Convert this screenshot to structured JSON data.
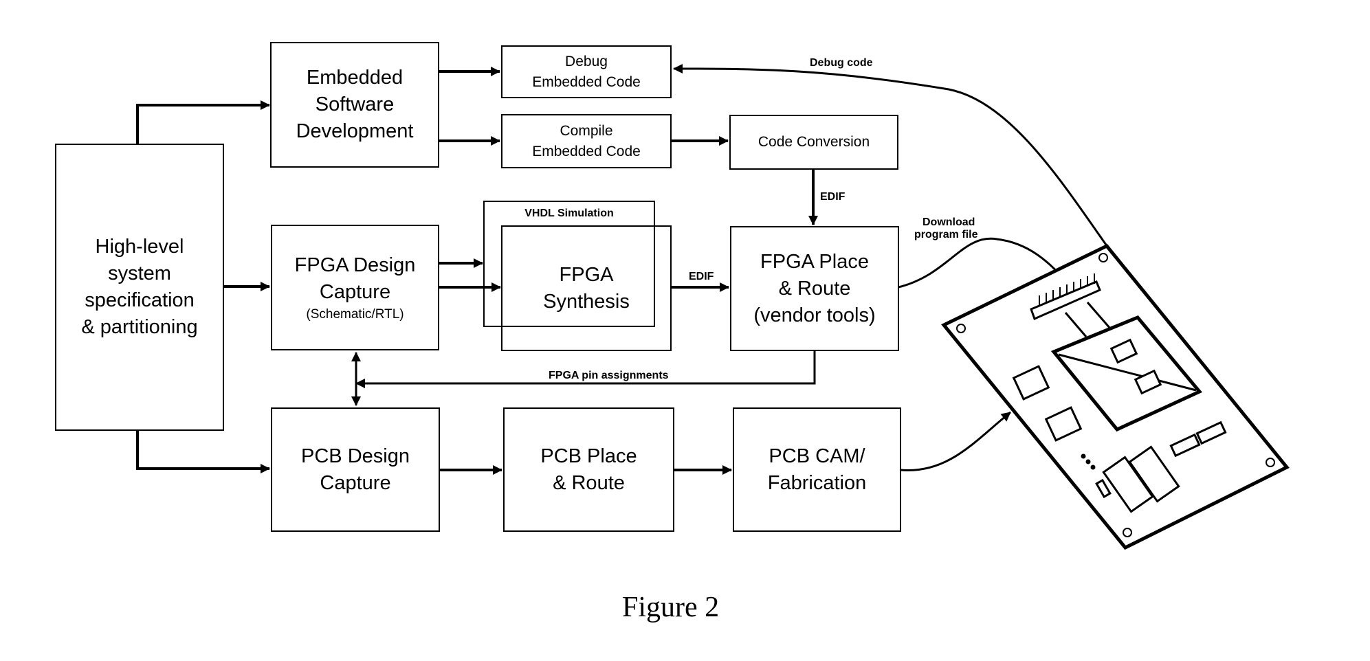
{
  "diagram": {
    "caption": "Figure 2",
    "boxes": {
      "high_level": [
        "High-level",
        "system",
        "specification",
        "& partitioning"
      ],
      "embedded_sw": [
        "Embedded",
        "Software",
        "Development"
      ],
      "debug_code": [
        "Debug",
        "Embedded Code"
      ],
      "compile_code": [
        "Compile",
        "Embedded Code"
      ],
      "code_conversion": "Code Conversion",
      "fpga_design_capture": [
        "FPGA Design",
        "Capture",
        "(Schematic/RTL)"
      ],
      "vhdl_simulation": "VHDL Simulation",
      "fpga_synthesis": [
        "FPGA",
        "Synthesis"
      ],
      "fpga_place_route": [
        "FPGA Place",
        "& Route",
        "(vendor tools)"
      ],
      "pcb_design_capture": [
        "PCB Design",
        "Capture"
      ],
      "pcb_place_route": [
        "PCB Place",
        "& Route"
      ],
      "pcb_cam": [
        "PCB CAM/",
        "Fabrication"
      ]
    },
    "edge_labels": {
      "debug_code": "Debug code",
      "edif_vertical": "EDIF",
      "edif_horizontal": "EDIF",
      "download_line1": "Download",
      "download_line2": "program file",
      "pin_assignments": "FPGA pin assignments"
    },
    "illustration": "printed-circuit-board"
  }
}
